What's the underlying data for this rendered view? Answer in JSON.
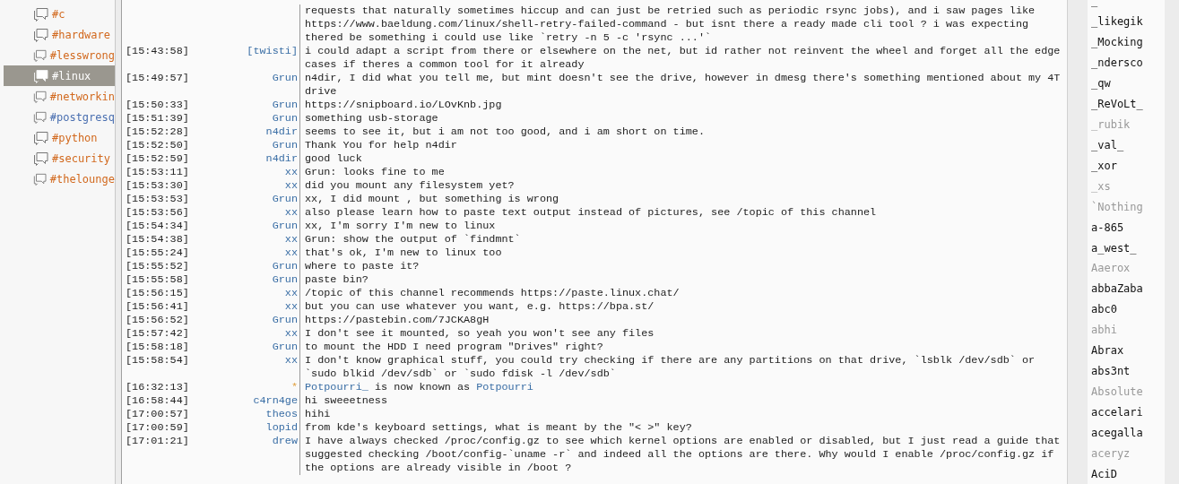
{
  "channels": [
    {
      "name": "#c",
      "color": "#d2691e",
      "selected": false
    },
    {
      "name": "#hardware",
      "color": "#d2691e",
      "selected": false
    },
    {
      "name": "#lesswrong",
      "color": "#d2691e",
      "selected": false
    },
    {
      "name": "#linux",
      "color": "#ffffff",
      "selected": true
    },
    {
      "name": "#networkin",
      "color": "#d2691e",
      "selected": false
    },
    {
      "name": "#postgresq",
      "color": "#4a6fb0",
      "selected": false
    },
    {
      "name": "#python",
      "color": "#d2691e",
      "selected": false
    },
    {
      "name": "#security",
      "color": "#d2691e",
      "selected": false
    },
    {
      "name": "#thelounge",
      "color": "#d2691e",
      "selected": false
    }
  ],
  "messages": [
    {
      "kind": "continuation",
      "text": "requests that naturally sometimes hiccup and can just be retried such as periodic rsync jobs), and i saw pages like https://www.baeldung.com/linux/shell-retry-failed-command - but isnt there a ready made cli tool ? i was expecting thered be something i could use like `retry -n 5 -c 'rsync ...'`"
    },
    {
      "kind": "message",
      "time": "[15:43:58]",
      "nick": "[twisti]",
      "text": "i could adapt a script from there or elsewhere on the net, but id rather not reinvent the wheel and forget all the edge cases if theres a common tool for it already"
    },
    {
      "kind": "message",
      "time": "[15:49:57]",
      "nick": "Grun",
      "text": "n4dir, I did what you tell me, but mint doesn't see the drive, however in dmesg there's something mentioned about my 4T drive"
    },
    {
      "kind": "message",
      "time": "[15:50:33]",
      "nick": "Grun",
      "text": "https://snipboard.io/LOvKnb.jpg"
    },
    {
      "kind": "message",
      "time": "[15:51:39]",
      "nick": "Grun",
      "text": "something usb-storage"
    },
    {
      "kind": "message",
      "time": "[15:52:28]",
      "nick": "n4dir",
      "text": "seems to see it, but i am not too good, and i am short on time."
    },
    {
      "kind": "message",
      "time": "[15:52:50]",
      "nick": "Grun",
      "text": "Thank You for help n4dir"
    },
    {
      "kind": "message",
      "time": "[15:52:59]",
      "nick": "n4dir",
      "text": "good luck"
    },
    {
      "kind": "message",
      "time": "[15:53:11]",
      "nick": "xx",
      "text": "Grun: looks fine to me"
    },
    {
      "kind": "message",
      "time": "[15:53:30]",
      "nick": "xx",
      "text": "did you mount any filesystem yet?"
    },
    {
      "kind": "message",
      "time": "[15:53:53]",
      "nick": "Grun",
      "text": "xx, I did mount , but something is wrong"
    },
    {
      "kind": "message",
      "time": "[15:53:56]",
      "nick": "xx",
      "text": "also please learn how to paste text output instead of pictures, see /topic of this channel"
    },
    {
      "kind": "message",
      "time": "[15:54:34]",
      "nick": "Grun",
      "text": "xx, I'm sorry I'm new to linux"
    },
    {
      "kind": "message",
      "time": "[15:54:38]",
      "nick": "xx",
      "text": "Grun: show the output of `findmnt`"
    },
    {
      "kind": "message",
      "time": "[15:55:24]",
      "nick": "xx",
      "text": "that's ok, I'm new to linux too"
    },
    {
      "kind": "message",
      "time": "[15:55:52]",
      "nick": "Grun",
      "text": "where to paste it?"
    },
    {
      "kind": "message",
      "time": "[15:55:58]",
      "nick": "Grun",
      "text": "paste bin?"
    },
    {
      "kind": "message",
      "time": "[15:56:15]",
      "nick": "xx",
      "text": "/topic of this channel recommends https://paste.linux.chat/"
    },
    {
      "kind": "message",
      "time": "[15:56:41]",
      "nick": "xx",
      "text": "but you can use whatever you want, e.g. https://bpa.st/"
    },
    {
      "kind": "message",
      "time": "[15:56:52]",
      "nick": "Grun",
      "text": "https://pastebin.com/7JCKA8gH"
    },
    {
      "kind": "message",
      "time": "[15:57:42]",
      "nick": "xx",
      "text": "I don't see it mounted, so yeah you won't see any files"
    },
    {
      "kind": "message",
      "time": "[15:58:18]",
      "nick": "Grun",
      "text": "to mount the HDD I need program \"Drives\" right?"
    },
    {
      "kind": "message",
      "time": "[15:58:54]",
      "nick": "xx",
      "text": "I don't know graphical stuff, you could try checking if there are any partitions on that drive, `lsblk /dev/sdb` or `sudo blkid /dev/sdb` or `sudo fdisk -l /dev/sdb`"
    },
    {
      "kind": "nick_change",
      "time": "[16:32:13]",
      "nick": "*",
      "old": "Potpourri_",
      "text": "is now known as",
      "new": "Potpourri"
    },
    {
      "kind": "message",
      "time": "[16:58:44]",
      "nick": "c4rn4ge",
      "text": "hi sweeetness"
    },
    {
      "kind": "message",
      "time": "[17:00:57]",
      "nick": "theos",
      "text": "hihi"
    },
    {
      "kind": "message",
      "time": "[17:00:59]",
      "nick": "lopid",
      "text": "from kde's keyboard settings, what is meant by the \"< >\" key?"
    },
    {
      "kind": "message",
      "time": "[17:01:21]",
      "nick": "drew",
      "text": "I have always checked /proc/config.gz to see which kernel options are enabled or disabled, but I just read a guide that suggested checking /boot/config-`uname -r` and indeed all the options are there. Why would I enable /proc/config.gz if the options are already visible in /boot ?"
    }
  ],
  "users": [
    {
      "name": "_",
      "away": false
    },
    {
      "name": "_likegik",
      "away": false
    },
    {
      "name": "_Mocking",
      "away": false
    },
    {
      "name": "_ndersco",
      "away": false
    },
    {
      "name": "_qw",
      "away": false
    },
    {
      "name": "_ReVoLt_",
      "away": false
    },
    {
      "name": "_rubik",
      "away": true
    },
    {
      "name": "_val_",
      "away": false
    },
    {
      "name": "_xor",
      "away": false
    },
    {
      "name": "_xs",
      "away": true
    },
    {
      "name": "`Nothing",
      "away": true
    },
    {
      "name": "a-865",
      "away": false
    },
    {
      "name": "a_west_",
      "away": false
    },
    {
      "name": "Aaerox",
      "away": true
    },
    {
      "name": "abbaZaba",
      "away": false
    },
    {
      "name": "abc0",
      "away": false
    },
    {
      "name": "abhi",
      "away": true
    },
    {
      "name": "Abrax",
      "away": false
    },
    {
      "name": "abs3nt",
      "away": false
    },
    {
      "name": "Absolute",
      "away": true
    },
    {
      "name": "accelari",
      "away": false
    },
    {
      "name": "acegalla",
      "away": false
    },
    {
      "name": "aceryz",
      "away": true
    },
    {
      "name": "AciD",
      "away": false
    }
  ]
}
